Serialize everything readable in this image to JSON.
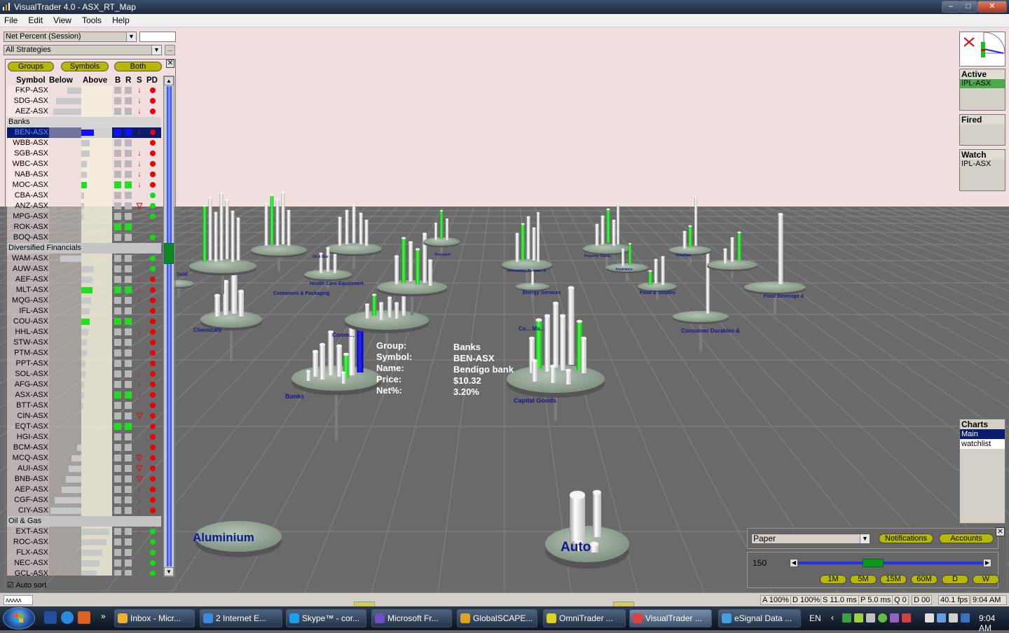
{
  "window": {
    "title": "VisualTrader 4.0 - ASX_RT_Map",
    "min": "–",
    "max": "□",
    "close": "✕"
  },
  "menu": [
    "File",
    "Edit",
    "View",
    "Tools",
    "Help"
  ],
  "left": {
    "metric_combo": "Net Percent (Session)",
    "strategy_combo": "All Strategies",
    "strategy_more": "...",
    "pills": [
      "Groups",
      "Symbols",
      "Both"
    ],
    "close": "✕",
    "headers": {
      "symbol": "Symbol",
      "below": "Below",
      "above": "Above",
      "b": "B",
      "r": "R",
      "s": "S",
      "pd": "PD"
    },
    "auto_sort": "Auto sort",
    "rows": [
      {
        "sym": "FKP-ASX",
        "bel": 20,
        "abv": 0,
        "b": 0,
        "r": 0,
        "s": "d",
        "pd": "r"
      },
      {
        "sym": "SDG-ASX",
        "bel": 36,
        "abv": 0,
        "b": 0,
        "r": 0,
        "s": "d",
        "pd": "r"
      },
      {
        "sym": "AEZ-ASX",
        "bel": 40,
        "abv": 0,
        "b": 0,
        "r": 0,
        "s": "d",
        "pd": "r"
      },
      {
        "grp": "Banks"
      },
      {
        "sym": "BEN-ASX",
        "bel": 0,
        "abv": 18,
        "b": "blue",
        "r": "blue",
        "s": "d",
        "pd": "r",
        "sel": 1
      },
      {
        "sym": "WBB-ASX",
        "bel": 0,
        "abv": 12,
        "b": 0,
        "r": 0,
        "s": "",
        "pd": "r"
      },
      {
        "sym": "SGB-ASX",
        "bel": 0,
        "abv": 12,
        "b": 0,
        "r": 0,
        "s": "d",
        "pd": "r"
      },
      {
        "sym": "WBC-ASX",
        "bel": 0,
        "abv": 8,
        "b": 0,
        "r": 0,
        "s": "d",
        "pd": "r"
      },
      {
        "sym": "NAB-ASX",
        "bel": 0,
        "abv": 8,
        "b": 0,
        "r": 0,
        "s": "d",
        "pd": "r"
      },
      {
        "sym": "MOC-ASX",
        "bel": 0,
        "abv": 8,
        "b": "green",
        "r": "green",
        "s": "d",
        "pd": "r",
        "abvc": "#22dd22"
      },
      {
        "sym": "CBA-ASX",
        "bel": 0,
        "abv": 4,
        "b": 0,
        "r": 0,
        "s": "",
        "pd": "g"
      },
      {
        "sym": "ANZ-ASX",
        "bel": 0,
        "abv": 4,
        "b": 0,
        "r": 0,
        "s": "t",
        "pd": "g"
      },
      {
        "sym": "MPG-ASX",
        "bel": 0,
        "abv": 3,
        "b": 0,
        "r": 0,
        "s": "u",
        "pd": "g"
      },
      {
        "sym": "ROK-ASX",
        "bel": 0,
        "abv": 0,
        "b": "green",
        "r": "green",
        "s": "",
        "pd": ""
      },
      {
        "sym": "BOQ-ASX",
        "bel": 0,
        "abv": 0,
        "b": 0,
        "r": 0,
        "s": "",
        "pd": "g"
      },
      {
        "grp": "Diversified Financials"
      },
      {
        "sym": "WAM-ASX",
        "bel": 30,
        "abv": 0,
        "b": 0,
        "r": 0,
        "s": "",
        "pd": "g"
      },
      {
        "sym": "AUW-ASX",
        "bel": 0,
        "abv": 18,
        "b": 0,
        "r": 0,
        "s": "",
        "pd": "g"
      },
      {
        "sym": "AEF-ASX",
        "bel": 0,
        "abv": 16,
        "b": 0,
        "r": 0,
        "s": "d",
        "pd": "r"
      },
      {
        "sym": "MLT-ASX",
        "bel": 0,
        "abv": 16,
        "b": "green",
        "r": "green",
        "s": "d",
        "pd": "r",
        "abvc": "#22dd22"
      },
      {
        "sym": "MQG-ASX",
        "bel": 0,
        "abv": 14,
        "b": 0,
        "r": 0,
        "s": "d",
        "pd": "r"
      },
      {
        "sym": "IFL-ASX",
        "bel": 0,
        "abv": 12,
        "b": 0,
        "r": 0,
        "s": "",
        "pd": "r"
      },
      {
        "sym": "COU-ASX",
        "bel": 0,
        "abv": 12,
        "b": "green",
        "r": "green",
        "s": "u",
        "pd": "r",
        "abvc": "#22dd22"
      },
      {
        "sym": "HHL-ASX",
        "bel": 0,
        "abv": 10,
        "b": 0,
        "r": 0,
        "s": "d",
        "pd": "r"
      },
      {
        "sym": "STW-ASX",
        "bel": 0,
        "abv": 8,
        "b": 0,
        "r": 0,
        "s": "u",
        "pd": "r"
      },
      {
        "sym": "PTM-ASX",
        "bel": 0,
        "abv": 8,
        "b": 0,
        "r": 0,
        "s": "",
        "pd": "r"
      },
      {
        "sym": "PPT-ASX",
        "bel": 0,
        "abv": 6,
        "b": 0,
        "r": 0,
        "s": "u",
        "pd": "r"
      },
      {
        "sym": "SOL-ASX",
        "bel": 0,
        "abv": 6,
        "b": 0,
        "r": 0,
        "s": "d",
        "pd": "r"
      },
      {
        "sym": "AFG-ASX",
        "bel": 0,
        "abv": 4,
        "b": 0,
        "r": 0,
        "s": "d",
        "pd": "r"
      },
      {
        "sym": "ASX-ASX",
        "bel": 0,
        "abv": 4,
        "b": "green",
        "r": "green",
        "s": "d",
        "pd": "r"
      },
      {
        "sym": "BTT-ASX",
        "bel": 0,
        "abv": 3,
        "b": 0,
        "r": 0,
        "s": "",
        "pd": "r"
      },
      {
        "sym": "CIN-ASX",
        "bel": 0,
        "abv": 0,
        "b": 0,
        "r": 0,
        "s": "t",
        "pd": "r"
      },
      {
        "sym": "EQT-ASX",
        "bel": 0,
        "abv": 0,
        "b": "green",
        "r": "green",
        "s": "",
        "pd": "r"
      },
      {
        "sym": "HGI-ASX",
        "bel": 0,
        "abv": 0,
        "b": 0,
        "r": 0,
        "s": "u",
        "pd": "r"
      },
      {
        "sym": "BCM-ASX",
        "bel": 6,
        "abv": 0,
        "b": 0,
        "r": 0,
        "s": "",
        "pd": "r"
      },
      {
        "sym": "MCQ-ASX",
        "bel": 14,
        "abv": 0,
        "b": 0,
        "r": 0,
        "s": "t",
        "pd": "r"
      },
      {
        "sym": "AUI-ASX",
        "bel": 18,
        "abv": 0,
        "b": 0,
        "r": 0,
        "s": "t",
        "pd": "r"
      },
      {
        "sym": "BNB-ASX",
        "bel": 22,
        "abv": 0,
        "b": 0,
        "r": 0,
        "s": "t",
        "pd": "r"
      },
      {
        "sym": "AEP-ASX",
        "bel": 28,
        "abv": 0,
        "b": 0,
        "r": 0,
        "s": "d",
        "pd": "r"
      },
      {
        "sym": "CGF-ASX",
        "bel": 38,
        "abv": 0,
        "b": 0,
        "r": 0,
        "s": "d",
        "pd": "r"
      },
      {
        "sym": "CIY-ASX",
        "bel": 44,
        "abv": 0,
        "b": 0,
        "r": 0,
        "s": "d",
        "pd": "r"
      },
      {
        "grp": "Oil & Gas"
      },
      {
        "sym": "EXT-ASX",
        "bel": 0,
        "abv": 40,
        "b": 0,
        "r": 0,
        "s": "d",
        "pd": "g"
      },
      {
        "sym": "ROC-ASX",
        "bel": 0,
        "abv": 36,
        "b": 0,
        "r": 0,
        "s": "",
        "pd": "g"
      },
      {
        "sym": "FLX-ASX",
        "bel": 0,
        "abv": 30,
        "b": 0,
        "r": 0,
        "s": "u",
        "pd": "g"
      },
      {
        "sym": "NEC-ASX",
        "bel": 0,
        "abv": 26,
        "b": 0,
        "r": 0,
        "s": "",
        "pd": "g"
      },
      {
        "sym": "GCL-ASX",
        "bel": 0,
        "abv": 22,
        "b": 0,
        "r": 0,
        "s": "u",
        "pd": "g"
      }
    ]
  },
  "scene": {
    "labels": {
      "gold": "Gold",
      "containers": "Containers & Packaging",
      "health": "Health Care Equipment",
      "chemicals": "Chemicals",
      "banks": "Banks",
      "commercial": "Comm...",
      "capital": "Capital Goods",
      "construction": "Co... Ma...",
      "energy": "Energy Services",
      "it": "Information Software &",
      "food_staples": "Food & Staples",
      "food_bev": "Food Beverage &",
      "consumer": "Consumer Durables &",
      "insurance": "Insurance",
      "retailing": "Retailing",
      "property": "Property Trusts",
      "aluminium": "Aluminium",
      "auto": "Auto",
      "oilgas": "Oil & Gas",
      "transport": "Transport"
    },
    "tooltip": {
      "k1": "Group:",
      "v1": "Banks",
      "k2": "Symbol:",
      "v2": "BEN-ASX",
      "k3": "Name:",
      "v3": "Bendigo bank",
      "k4": "Price:",
      "v4": "$10.32",
      "k5": "Net%:",
      "v5": "3.20%"
    }
  },
  "right": {
    "active": {
      "title": "Active",
      "items": [
        "IPL-ASX"
      ]
    },
    "fired": {
      "title": "Fired",
      "items": []
    },
    "watch": {
      "title": "Watch",
      "items": [
        "IPL-ASX"
      ]
    },
    "charts": {
      "title": "Charts",
      "items": [
        "Main",
        "watchlist"
      ]
    }
  },
  "broker": {
    "account": "Paper",
    "notifications": "Notifications",
    "accounts": "Accounts",
    "close": "✕",
    "speed": "150",
    "timeframes": [
      "1M",
      "5M",
      "15M",
      "60M",
      "D",
      "W"
    ]
  },
  "status": {
    "wave": "ᴧᴧᴧᴧᴧ",
    "a": "A 100%",
    "d": "D 100%",
    "s": "S 11.0 ms",
    "p": "P 5.0 ms",
    "q": "Q 0",
    "dd": "D 00",
    "fps": "40.1 fps",
    "time": "9:04 AM"
  },
  "taskbar": {
    "items": [
      {
        "label": "Inbox - Micr...",
        "c": "#f0b030"
      },
      {
        "label": "2 Internet E...",
        "c": "#3a8ae0"
      },
      {
        "label": "Skype™ - cor...",
        "c": "#1aa0f0"
      },
      {
        "label": "Microsoft Fr...",
        "c": "#7050c0"
      },
      {
        "label": "GlobalSCAPE...",
        "c": "#e0a020"
      },
      {
        "label": "OmniTrader ...",
        "c": "#e0d020"
      },
      {
        "label": "VisualTrader ...",
        "c": "#e04040"
      },
      {
        "label": "eSignal Data ...",
        "c": "#40a0e0"
      }
    ],
    "lang": "EN",
    "clock": "9:04 AM",
    "more": "»",
    "tray_more": "‹"
  },
  "colors": {
    "sky": "#f1dfe0",
    "floor": "#6a6a6a",
    "platform": "#9aaa9a",
    "accent_green": "#22dd22",
    "accent_blue": "#1010ff"
  }
}
